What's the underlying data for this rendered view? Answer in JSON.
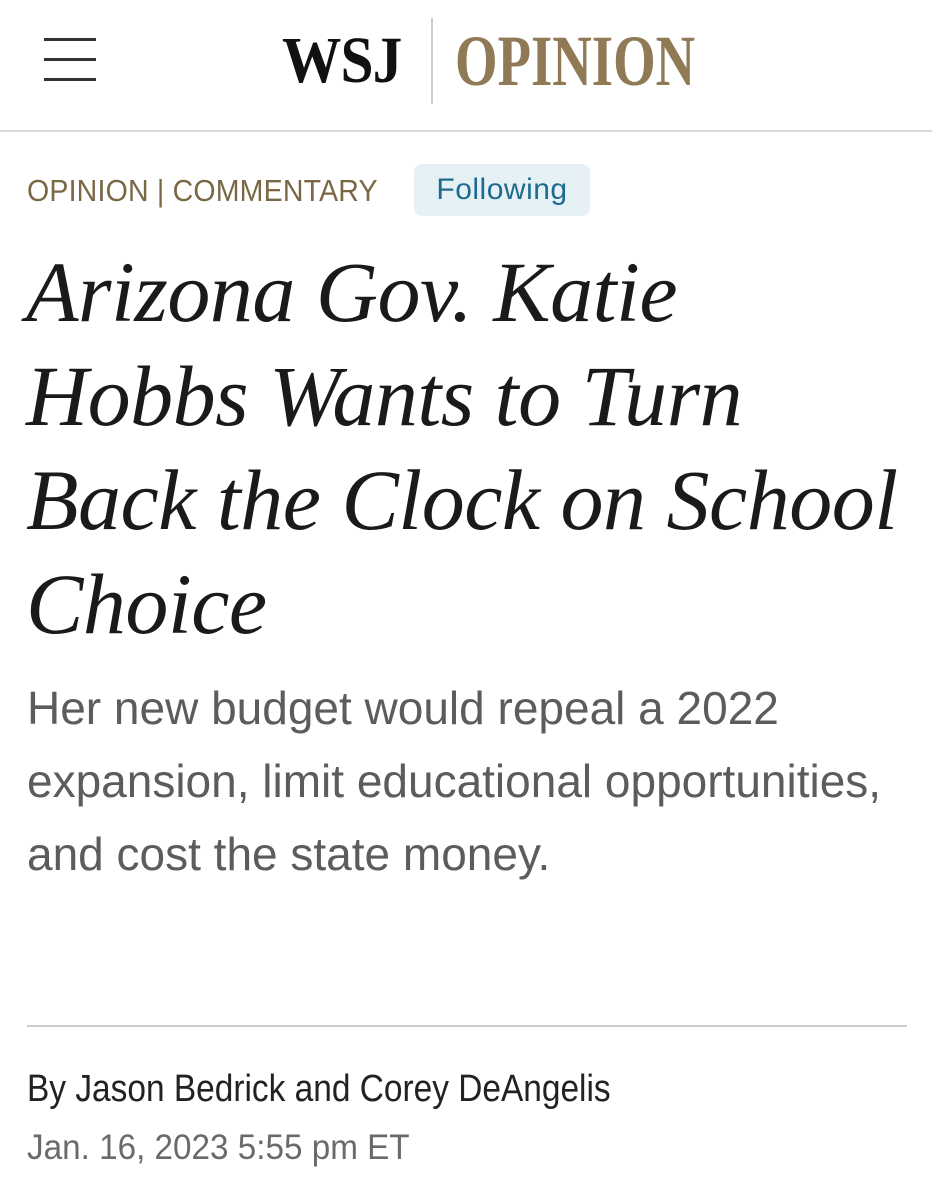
{
  "header": {
    "menu_icon": "hamburger-menu-icon",
    "logo_wsj": "WSJ",
    "logo_section": "OPINION"
  },
  "article": {
    "kicker_section": "OPINION",
    "kicker_separator": "|",
    "kicker_category": "COMMENTARY",
    "follow_label": "Following",
    "headline": "Arizona Gov. Katie Hobbs Wants to Turn Back the Clock on School Choice",
    "dek": "Her new budget would repeal a 2022 expansion, limit educational opportunities, and cost the state money.",
    "byline": "By Jason Bedrick and Corey DeAngelis",
    "dateline": "Jan. 16, 2023 5:55 pm ET"
  },
  "colors": {
    "brand_gold": "#8f7a55",
    "kicker": "#7a6744",
    "follow_bg": "#e6f1f6",
    "follow_text": "#1e6b8f"
  }
}
